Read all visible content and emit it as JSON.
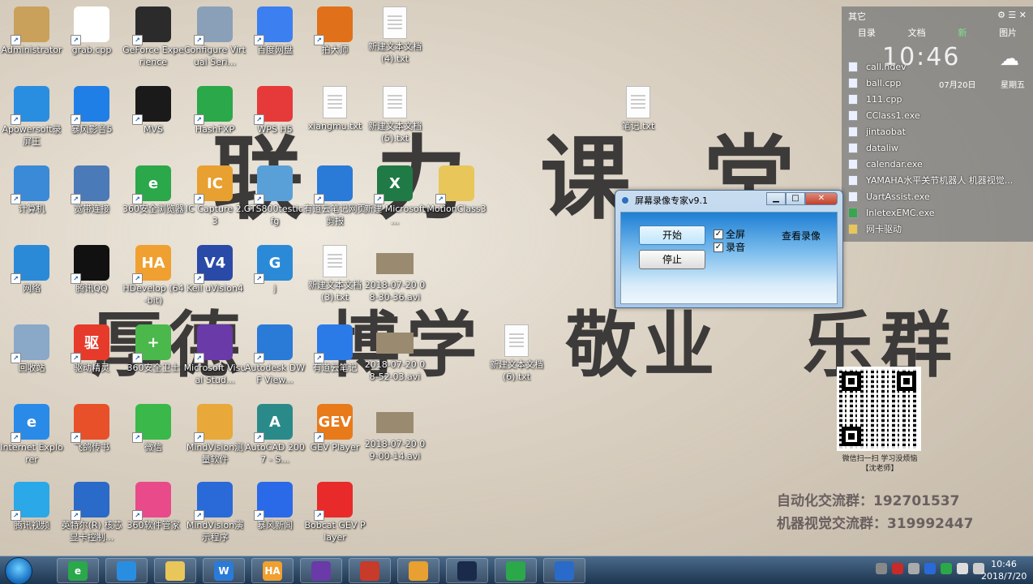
{
  "slogan": {
    "top": "联力课堂",
    "mid": [
      "厚德",
      "博学",
      "敬业",
      "乐群"
    ]
  },
  "desktop_icons": [
    {
      "label": "Administrator",
      "color": "#c9a15a",
      "glyph": "",
      "col": 0,
      "row": 0
    },
    {
      "label": "grab.cpp",
      "color": "#ffffff",
      "glyph": "C++",
      "col": 1,
      "row": 0
    },
    {
      "label": "GeForce Experience",
      "color": "#2b2b2b",
      "glyph": "",
      "col": 2,
      "row": 0
    },
    {
      "label": "Configure Virtual Seri...",
      "color": "#8aa0b8",
      "glyph": "",
      "col": 3,
      "row": 0
    },
    {
      "label": "百度网盘",
      "color": "#3b7ff0",
      "glyph": "",
      "col": 4,
      "row": 0
    },
    {
      "label": "拍大师",
      "color": "#e0701a",
      "glyph": "",
      "col": 5,
      "row": 0
    },
    {
      "label": "新建文本文档(4).txt",
      "type": "file",
      "col": 6,
      "row": 0
    },
    {
      "label": "Apowersoft录屏王",
      "color": "#2a8ee0",
      "glyph": "",
      "col": 0,
      "row": 1
    },
    {
      "label": "暴风影音5",
      "color": "#1f7fe6",
      "glyph": "",
      "col": 1,
      "row": 1
    },
    {
      "label": "MVS",
      "color": "#1a1a1a",
      "glyph": "",
      "col": 2,
      "row": 1
    },
    {
      "label": "HashFXP",
      "color": "#2aa84a",
      "glyph": "",
      "col": 3,
      "row": 1
    },
    {
      "label": "WPS H5",
      "color": "#e63a3a",
      "glyph": "",
      "col": 4,
      "row": 1
    },
    {
      "label": "xiangmu.txt",
      "type": "file",
      "col": 5,
      "row": 1
    },
    {
      "label": "新建文本文档(5).txt",
      "type": "file",
      "col": 6,
      "row": 1
    },
    {
      "label": "笔记.txt",
      "type": "file",
      "col": 10,
      "row": 1
    },
    {
      "label": "计算机",
      "color": "#3a8ad8",
      "glyph": "",
      "col": 0,
      "row": 2
    },
    {
      "label": "宽带连接",
      "color": "#4a7ab8",
      "glyph": "",
      "col": 1,
      "row": 2
    },
    {
      "label": "360安全浏览器",
      "color": "#2aa84a",
      "glyph": "e",
      "col": 2,
      "row": 2
    },
    {
      "label": "IC Capture 2.3",
      "color": "#e8a030",
      "glyph": "IC",
      "col": 3,
      "row": 2
    },
    {
      "label": "GTS800testic.fg",
      "color": "#5aa0d8",
      "glyph": "",
      "col": 4,
      "row": 2
    },
    {
      "label": "有道云笔记网页剪报",
      "color": "#2a7ad8",
      "glyph": "",
      "col": 5,
      "row": 2
    },
    {
      "label": "新建 Microsoft ...",
      "color": "#1f7a45",
      "glyph": "X",
      "col": 6,
      "row": 2
    },
    {
      "label": "MotionClass3",
      "color": "#e8c65a",
      "glyph": "",
      "col": 7,
      "row": 2
    },
    {
      "label": "网络",
      "color": "#2a8ad8",
      "glyph": "",
      "col": 0,
      "row": 3
    },
    {
      "label": "腾讯QQ",
      "color": "#111111",
      "glyph": "",
      "col": 1,
      "row": 3
    },
    {
      "label": "HDevelop (64-bit)",
      "color": "#f0a030",
      "glyph": "HA",
      "col": 2,
      "row": 3
    },
    {
      "label": "Keil uVision4",
      "color": "#2a4aa8",
      "glyph": "V4",
      "col": 3,
      "row": 3
    },
    {
      "label": "j",
      "color": "#2a8ad8",
      "glyph": "G",
      "col": 4,
      "row": 3
    },
    {
      "label": "新建文本文档(3).txt",
      "type": "file",
      "col": 5,
      "row": 3
    },
    {
      "label": "2018-07-20 08-30-36.avi",
      "type": "video",
      "col": 6,
      "row": 3
    },
    {
      "label": "回收站",
      "color": "#8aa8c8",
      "glyph": "",
      "col": 0,
      "row": 4
    },
    {
      "label": "驱动精灵",
      "color": "#e63a2a",
      "glyph": "驱",
      "col": 1,
      "row": 4
    },
    {
      "label": "360安全卫士",
      "color": "#4ab84a",
      "glyph": "+",
      "col": 2,
      "row": 4
    },
    {
      "label": "Microsoft Visual Stud...",
      "color": "#6a3aa8",
      "glyph": "",
      "col": 3,
      "row": 4
    },
    {
      "label": "Autodesk DWF View...",
      "color": "#2a7ad8",
      "glyph": "",
      "col": 4,
      "row": 4
    },
    {
      "label": "有道云笔记",
      "color": "#2a7ae8",
      "glyph": "",
      "col": 5,
      "row": 4
    },
    {
      "label": "2018-07-20 08-52-03.avi",
      "type": "video",
      "col": 6,
      "row": 4
    },
    {
      "label": "新建文本文档(6).txt",
      "type": "file",
      "col": 8,
      "row": 4
    },
    {
      "label": "Internet Explorer",
      "color": "#2a8ae8",
      "glyph": "e",
      "col": 0,
      "row": 5
    },
    {
      "label": "飞鸽传书",
      "color": "#e8502a",
      "glyph": "",
      "col": 1,
      "row": 5
    },
    {
      "label": "微信",
      "color": "#3ab84a",
      "glyph": "",
      "col": 2,
      "row": 5
    },
    {
      "label": "MindVision测量软件",
      "color": "#e8a83a",
      "glyph": "",
      "col": 3,
      "row": 5
    },
    {
      "label": "AutoCAD 2007 - S...",
      "color": "#2a8a8a",
      "glyph": "A",
      "col": 4,
      "row": 5
    },
    {
      "label": "GEV Player",
      "color": "#e87a1a",
      "glyph": "GEV",
      "col": 5,
      "row": 5
    },
    {
      "label": "2018-07-20 09-00-14.avi",
      "type": "video",
      "col": 6,
      "row": 5
    },
    {
      "label": "腾讯视频",
      "color": "#2aa8e8",
      "glyph": "",
      "col": 0,
      "row": 6
    },
    {
      "label": "英特尔(R) 核芯显卡控制...",
      "color": "#2a6ac8",
      "glyph": "",
      "col": 1,
      "row": 6
    },
    {
      "label": "360软件管家",
      "color": "#e84a8a",
      "glyph": "",
      "col": 2,
      "row": 6
    },
    {
      "label": "MindVision演示程序",
      "color": "#2a6ad8",
      "glyph": "",
      "col": 3,
      "row": 6
    },
    {
      "label": "暴风新闻",
      "color": "#2a6ae8",
      "glyph": "",
      "col": 4,
      "row": 6
    },
    {
      "label": "Bobcat GEV Player",
      "color": "#e82a2a",
      "glyph": "",
      "col": 5,
      "row": 6
    }
  ],
  "widget": {
    "top_left": "其它",
    "tabs": [
      "目录",
      "文档",
      "新",
      "图片"
    ],
    "active_tab": "新",
    "time": "10:46",
    "date": "07月20日",
    "weekday": "星期五",
    "files": [
      {
        "name": "call.hdev",
        "kind": "file"
      },
      {
        "name": "ball.cpp",
        "kind": "file"
      },
      {
        "name": "111.cpp",
        "kind": "file"
      },
      {
        "name": "CClass1.exe",
        "kind": "file"
      },
      {
        "name": "jintaobat",
        "kind": "file"
      },
      {
        "name": "dataliw",
        "kind": "file"
      },
      {
        "name": "calendar.exe",
        "kind": "file"
      },
      {
        "name": "YAMAHA水平关节机器人 机器视觉...",
        "kind": "file"
      },
      {
        "name": "UartAssist.exe",
        "kind": "file"
      },
      {
        "name": "InletexEMC.exe",
        "kind": "excel"
      },
      {
        "name": "网卡驱动",
        "kind": "folder"
      }
    ]
  },
  "qr": {
    "caption_line1": "微信扫一扫 学习没烦恼",
    "caption_line2": "【沈老师】"
  },
  "groups": {
    "line1": "自动化交流群：192701537",
    "line2": "机器视觉交流群：319992447"
  },
  "dialog": {
    "title": "屏幕录像专家v9.1",
    "start_label": "开始",
    "stop_label": "停止",
    "fullscreen_label": "全屏",
    "audio_label": "录音",
    "view_label": "查看录像",
    "fullscreen_checked": true,
    "audio_checked": true
  },
  "taskbar": {
    "items": [
      {
        "name": "360浏览器",
        "color": "#2aa84a",
        "glyph": "e"
      },
      {
        "name": "Apowersoft",
        "color": "#2a8ee0",
        "glyph": ""
      },
      {
        "name": "资源管理器",
        "color": "#e8c65a",
        "glyph": ""
      },
      {
        "name": "WPS",
        "color": "#2a7ad8",
        "glyph": "W"
      },
      {
        "name": "HDevelop",
        "color": "#f0a030",
        "glyph": "HA"
      },
      {
        "name": "Visual Studio",
        "color": "#6a3aa8",
        "glyph": ""
      },
      {
        "name": "工具箱",
        "color": "#c83a2a",
        "glyph": ""
      },
      {
        "name": "画图",
        "color": "#e8a030",
        "glyph": ""
      },
      {
        "name": "X",
        "color": "#1a2a4a",
        "glyph": ""
      },
      {
        "name": "记事",
        "color": "#2aa84a",
        "glyph": ""
      },
      {
        "name": "录像",
        "color": "#2a6ac8",
        "glyph": ""
      }
    ],
    "time": "10:46",
    "date": "2018/7/20"
  }
}
